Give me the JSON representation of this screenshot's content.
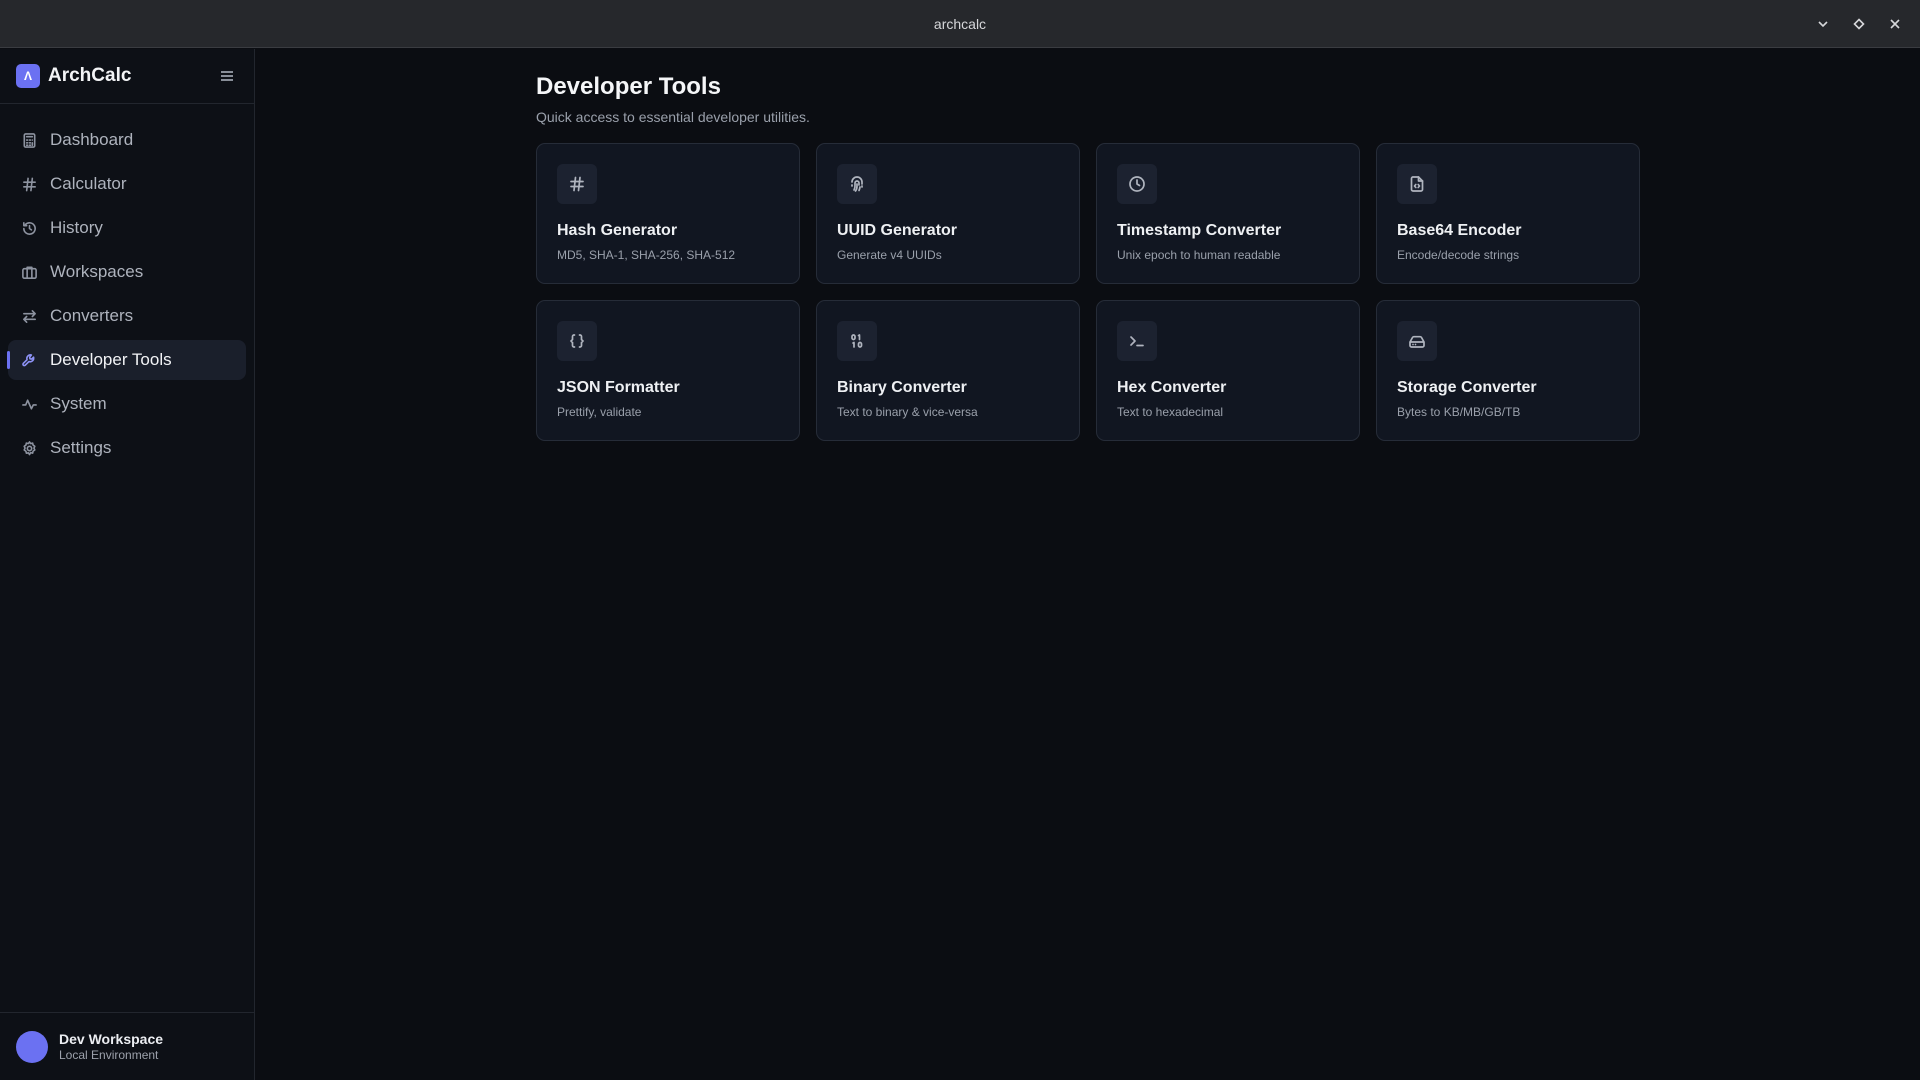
{
  "window": {
    "title": "archcalc"
  },
  "sidebar": {
    "brand": {
      "logo_letter": "Λ",
      "name": "ArchCalc"
    },
    "items": [
      {
        "label": "Dashboard",
        "icon": "calculator-icon",
        "active": false
      },
      {
        "label": "Calculator",
        "icon": "hash-icon",
        "active": false
      },
      {
        "label": "History",
        "icon": "history-icon",
        "active": false
      },
      {
        "label": "Workspaces",
        "icon": "briefcase-icon",
        "active": false
      },
      {
        "label": "Converters",
        "icon": "arrows-exchange-icon",
        "active": false
      },
      {
        "label": "Developer Tools",
        "icon": "wrench-icon",
        "active": true
      },
      {
        "label": "System",
        "icon": "activity-icon",
        "active": false
      },
      {
        "label": "Settings",
        "icon": "gear-icon",
        "active": false
      }
    ],
    "user": {
      "name": "Dev Workspace",
      "subtitle": "Local Environment"
    }
  },
  "main": {
    "title": "Developer Tools",
    "subtitle": "Quick access to essential developer utilities.",
    "tools": [
      {
        "name": "Hash Generator",
        "description": "MD5, SHA-1, SHA-256, SHA-512",
        "icon": "hash-icon"
      },
      {
        "name": "UUID Generator",
        "description": "Generate v4 UUIDs",
        "icon": "fingerprint-icon"
      },
      {
        "name": "Timestamp Converter",
        "description": "Unix epoch to human readable",
        "icon": "clock-icon"
      },
      {
        "name": "Base64 Encoder",
        "description": "Encode/decode strings",
        "icon": "file-code-icon"
      },
      {
        "name": "JSON Formatter",
        "description": "Prettify, validate",
        "icon": "braces-icon"
      },
      {
        "name": "Binary Converter",
        "description": "Text to binary & vice-versa",
        "icon": "binary-icon"
      },
      {
        "name": "Hex Converter",
        "description": "Text to hexadecimal",
        "icon": "terminal-icon"
      },
      {
        "name": "Storage Converter",
        "description": "Bytes to KB/MB/GB/TB",
        "icon": "hard-drive-icon"
      }
    ]
  },
  "colors": {
    "accent": "#6b71f2",
    "background": "#0b0d12",
    "card": "#111621",
    "sidebar": "#0d1016"
  }
}
